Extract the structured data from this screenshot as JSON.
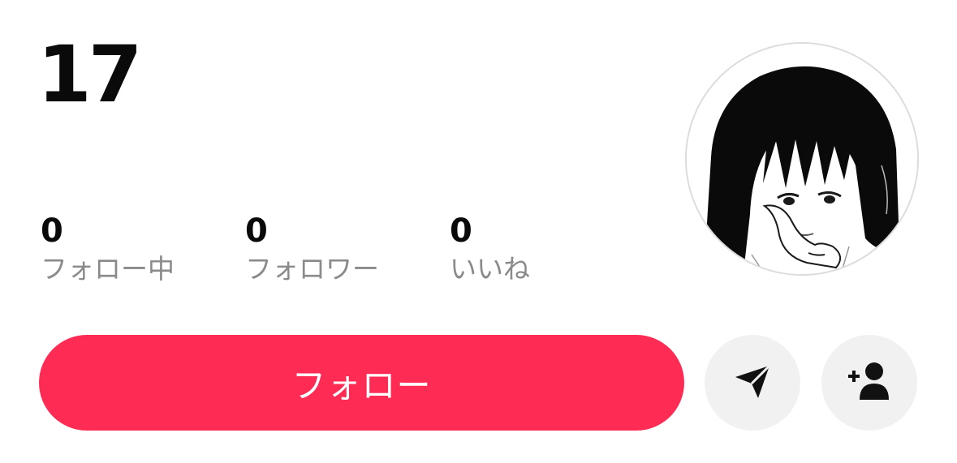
{
  "profile": {
    "name": "17"
  },
  "stats": [
    {
      "count": "0",
      "label": "フォロー中"
    },
    {
      "count": "0",
      "label": "フォロワー"
    },
    {
      "count": "0",
      "label": "いいね"
    }
  ],
  "actions": {
    "follow_label": "フォロー",
    "message_icon": "send-icon",
    "add_friend_icon": "add-user-icon"
  },
  "colors": {
    "follow_button": "#fe2c55",
    "round_button_bg": "#f1f1f2",
    "label_gray": "#8a8a8a"
  }
}
